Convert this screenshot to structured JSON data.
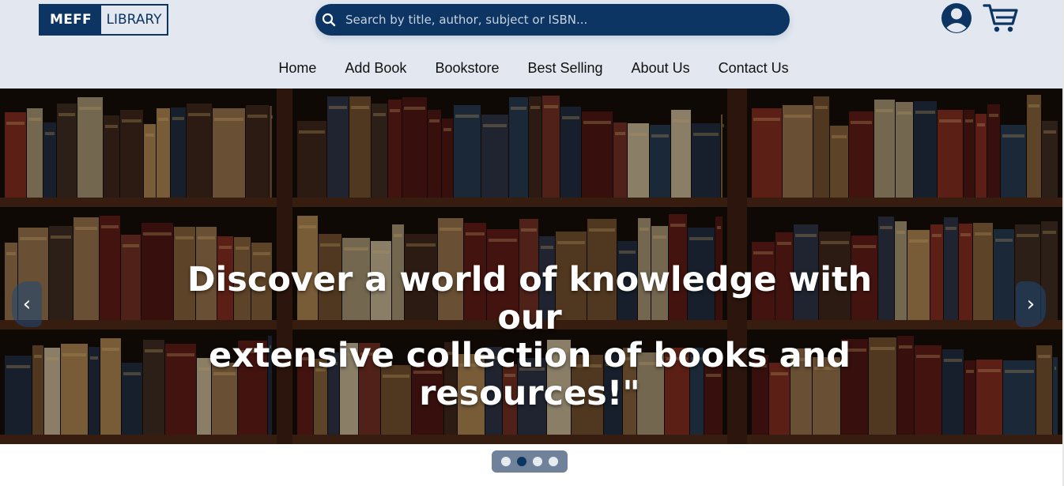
{
  "logo": {
    "left": "MEFF",
    "right": "LIBRARY"
  },
  "search": {
    "placeholder": "Search by title, author, subject or ISBN..."
  },
  "icons": {
    "search": "search-icon",
    "user": "user-icon",
    "cart": "cart-icon"
  },
  "nav": {
    "items": [
      "Home",
      "Add Book",
      "Bookstore",
      "Best Selling",
      "About Us",
      "Contact Us"
    ]
  },
  "hero": {
    "line1": "Discover a world of knowledge with our",
    "line2": "extensive collection of books and",
    "line3": "resources!\"",
    "prev": "‹",
    "next": "›"
  },
  "carousel": {
    "slide_count": 4,
    "active_index": 1
  },
  "colors": {
    "brand": "#0c3563",
    "header_bg": "#e3e8f0",
    "indicator_bg": "#6f8299"
  }
}
